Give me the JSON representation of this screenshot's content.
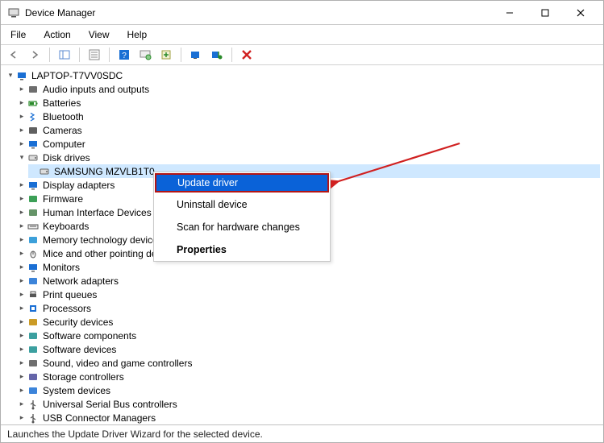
{
  "window": {
    "title": "Device Manager"
  },
  "menubar": [
    "File",
    "Action",
    "View",
    "Help"
  ],
  "toolbar": {
    "back": "◄",
    "forward": "►",
    "icons": [
      "prop",
      "help",
      "scan",
      "update",
      "monitor",
      "uninstall",
      "delete"
    ]
  },
  "tree": {
    "root": {
      "label": "LAPTOP-T7VV0SDC",
      "expanded": true
    },
    "nodes": [
      {
        "label": "Audio inputs and outputs",
        "icon": "audio"
      },
      {
        "label": "Batteries",
        "icon": "battery"
      },
      {
        "label": "Bluetooth",
        "icon": "bluetooth"
      },
      {
        "label": "Cameras",
        "icon": "camera"
      },
      {
        "label": "Computer",
        "icon": "computer"
      },
      {
        "label": "Disk drives",
        "icon": "disk",
        "expanded": true,
        "children": [
          {
            "label": "SAMSUNG MZVLB1T0",
            "icon": "disk",
            "selected": true
          }
        ]
      },
      {
        "label": "Display adapters",
        "icon": "display"
      },
      {
        "label": "Firmware",
        "icon": "firmware"
      },
      {
        "label": "Human Interface Devices",
        "icon": "hid"
      },
      {
        "label": "Keyboards",
        "icon": "keyboard"
      },
      {
        "label": "Memory technology devices",
        "icon": "memory"
      },
      {
        "label": "Mice and other pointing devices",
        "icon": "mouse"
      },
      {
        "label": "Monitors",
        "icon": "monitor"
      },
      {
        "label": "Network adapters",
        "icon": "network"
      },
      {
        "label": "Print queues",
        "icon": "printer"
      },
      {
        "label": "Processors",
        "icon": "cpu"
      },
      {
        "label": "Security devices",
        "icon": "security"
      },
      {
        "label": "Software components",
        "icon": "software"
      },
      {
        "label": "Software devices",
        "icon": "software"
      },
      {
        "label": "Sound, video and game controllers",
        "icon": "sound"
      },
      {
        "label": "Storage controllers",
        "icon": "storage"
      },
      {
        "label": "System devices",
        "icon": "system"
      },
      {
        "label": "Universal Serial Bus controllers",
        "icon": "usb"
      },
      {
        "label": "USB Connector Managers",
        "icon": "usb"
      }
    ]
  },
  "context_menu": {
    "items": [
      {
        "label": "Update driver",
        "highlighted": true
      },
      {
        "label": "Uninstall device"
      },
      {
        "label": "Scan for hardware changes"
      },
      {
        "label": "Properties",
        "bold": true
      }
    ]
  },
  "icon_colors": {
    "audio": "#555",
    "battery": "#2a8a2a",
    "bluetooth": "#1a6fd4",
    "camera": "#444",
    "computer": "#1a6fd4",
    "disk": "#666",
    "display": "#1a6fd4",
    "firmware": "#1a8f3a",
    "hid": "#4a814e",
    "keyboard": "#555",
    "memory": "#1a8fd4",
    "mouse": "#555",
    "monitor": "#1a6fd4",
    "network": "#1a6fd4",
    "printer": "#555",
    "cpu": "#1a6fd4",
    "security": "#c28a00",
    "software": "#1a8f8f",
    "sound": "#555",
    "storage": "#4a4a9a",
    "system": "#1a6fd4",
    "usb": "#555"
  },
  "statusbar": {
    "text": "Launches the Update Driver Wizard for the selected device."
  }
}
